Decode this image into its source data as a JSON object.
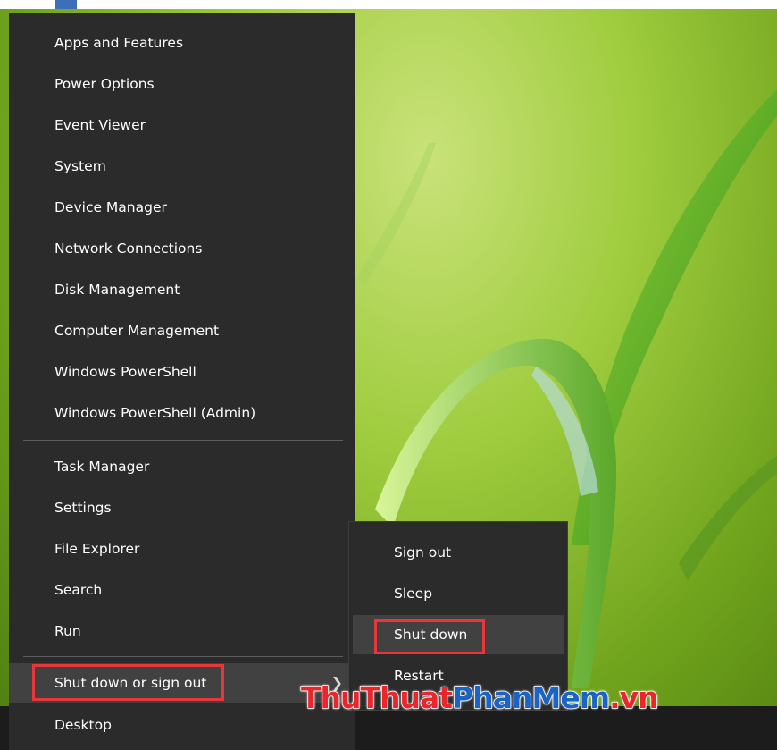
{
  "menu": {
    "items": [
      {
        "label": "Apps and Features"
      },
      {
        "label": "Power Options"
      },
      {
        "label": "Event Viewer"
      },
      {
        "label": "System"
      },
      {
        "label": "Device Manager"
      },
      {
        "label": "Network Connections"
      },
      {
        "label": "Disk Management"
      },
      {
        "label": "Computer Management"
      },
      {
        "label": "Windows PowerShell"
      },
      {
        "label": "Windows PowerShell (Admin)"
      },
      {
        "label": "Task Manager"
      },
      {
        "label": "Settings"
      },
      {
        "label": "File Explorer"
      },
      {
        "label": "Search"
      },
      {
        "label": "Run"
      },
      {
        "label": "Shut down or sign out"
      },
      {
        "label": "Desktop"
      }
    ]
  },
  "submenu": {
    "items": [
      {
        "label": "Sign out"
      },
      {
        "label": "Sleep"
      },
      {
        "label": "Shut down"
      },
      {
        "label": "Restart"
      }
    ]
  },
  "watermark": {
    "part1": "ThuThuat",
    "part2": "PhanMem",
    "part3": ".vn"
  },
  "colors": {
    "menu_bg": "#2b2b2b",
    "hover_bg": "#414141",
    "highlight_border": "#e8373b",
    "watermark_red": "#e8262b",
    "watermark_blue": "#1a63c7"
  },
  "icons": {
    "submenu_arrow": "chevron-right-icon"
  }
}
